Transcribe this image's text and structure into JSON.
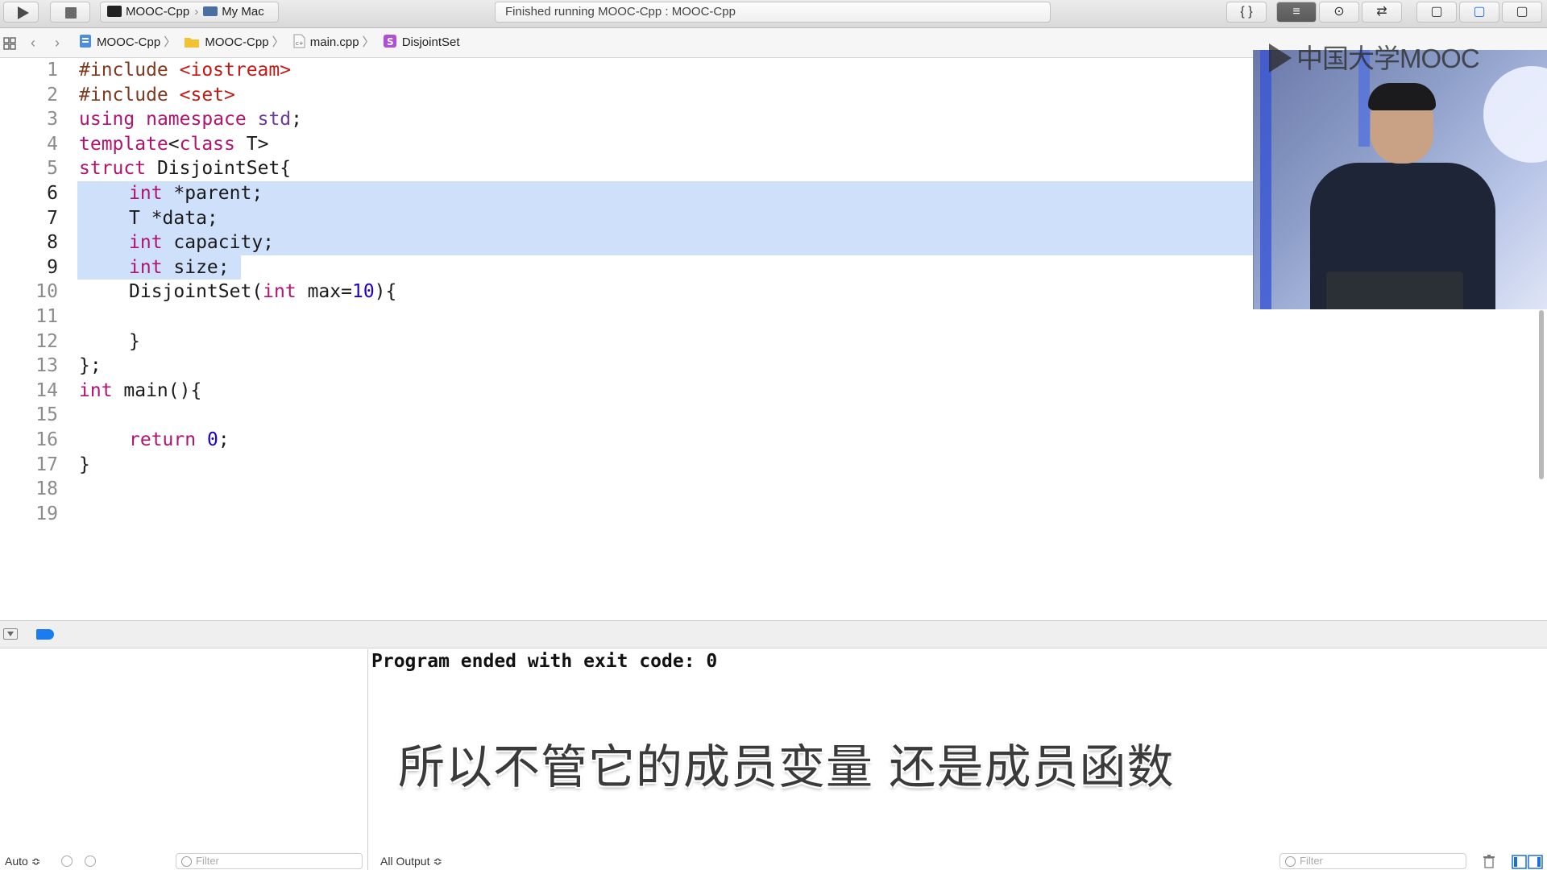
{
  "toolbar": {
    "scheme_project": "MOOC-Cpp",
    "scheme_destination": "My Mac",
    "status": "Finished running MOOC-Cpp : MOOC-Cpp",
    "right_buttons": [
      "{ }",
      "≡",
      "⊙",
      "⇄",
      "▢",
      "▢",
      "▢"
    ]
  },
  "jumpbar": {
    "crumbs": [
      {
        "label": "MOOC-Cpp",
        "icon": "project-icon"
      },
      {
        "label": "MOOC-Cpp",
        "icon": "folder-icon"
      },
      {
        "label": "main.cpp",
        "icon": "cpp-file-icon"
      },
      {
        "label": "DisjointSet",
        "icon": "struct-icon"
      }
    ]
  },
  "editor": {
    "line_numbers": [
      "1",
      "2",
      "3",
      "4",
      "5",
      "6",
      "7",
      "8",
      "9",
      "10",
      "11",
      "12",
      "13",
      "14",
      "15",
      "16",
      "17",
      "18",
      "19"
    ],
    "selected_lines": [
      6,
      7,
      8,
      9
    ],
    "code": {
      "l1_pp": "#include ",
      "l1_s": "<iostream>",
      "l2_pp": "#include ",
      "l2_s": "<set>",
      "l3_k1": "using",
      "l3_sp1": " ",
      "l3_k2": "namespace",
      "l3_sp2": " ",
      "l3_t": "std",
      "l3_end": ";",
      "l4_k1": "template",
      "l4_lt": "<",
      "l4_k2": "class",
      "l4_end": " T>",
      "l5_k": "struct",
      "l5_end": " DisjointSet{",
      "l6_k": "int",
      "l6_end": " *parent;",
      "l7": "T *data;",
      "l8_k": "int",
      "l8_end": " capacity;",
      "l9_k": "int",
      "l9_end": " size;",
      "l10_a": "DisjointSet(",
      "l10_k": "int",
      "l10_b": " max=",
      "l10_n": "10",
      "l10_c": "){",
      "l12": "}",
      "l13": "};",
      "l14_k": "int",
      "l14_end": " main(){",
      "l16_k": "return",
      "l16_sp": " ",
      "l16_n": "0",
      "l16_end": ";",
      "l17": "}"
    }
  },
  "overlay": {
    "logo_text": "中国大学MOOC"
  },
  "console": {
    "output": "Program ended with exit code: 0",
    "subtitle": "所以不管它的成员变量 还是成员函数"
  },
  "bottom": {
    "auto_label": "Auto ≎",
    "filter_placeholder": "Filter",
    "output_selector": "All Output ≎"
  },
  "colors": {
    "keyword": "#b1136f",
    "preprocessor": "#7e3b1f",
    "string": "#c41a16",
    "number": "#1c00cf",
    "selection": "#cfe0fb"
  }
}
